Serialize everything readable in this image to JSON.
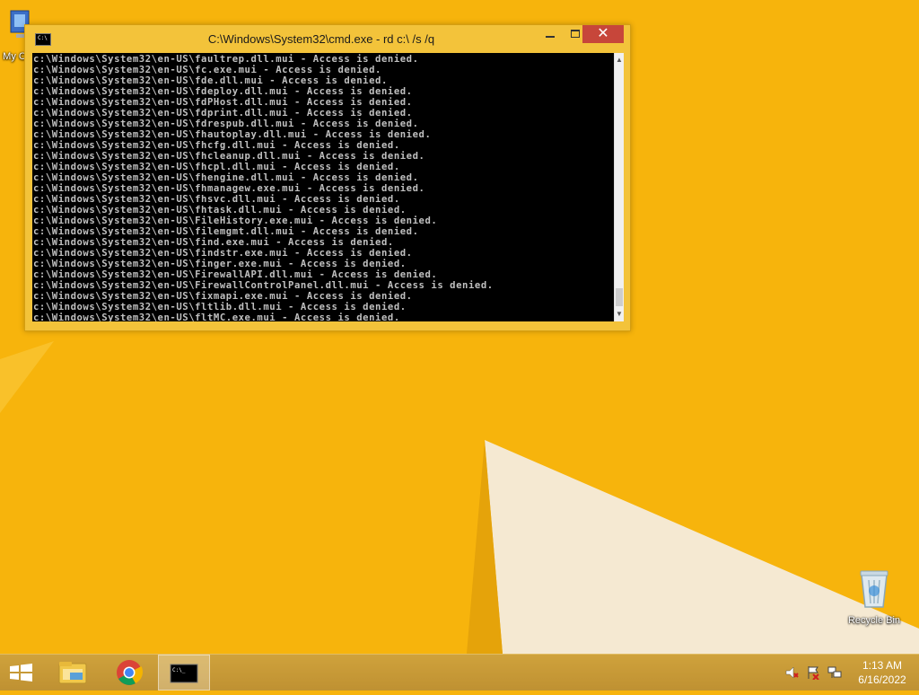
{
  "desktop": {
    "icons": [
      {
        "label": "My C"
      },
      {
        "label": "Recycle Bin"
      }
    ]
  },
  "cmd_window": {
    "title": "C:\\Windows\\System32\\cmd.exe - rd  c:\\ /s /q",
    "close_glyph": "✕",
    "lines": [
      "c:\\Windows\\System32\\en-US\\faultrep.dll.mui - Access is denied.",
      "c:\\Windows\\System32\\en-US\\fc.exe.mui - Access is denied.",
      "c:\\Windows\\System32\\en-US\\fde.dll.mui - Access is denied.",
      "c:\\Windows\\System32\\en-US\\fdeploy.dll.mui - Access is denied.",
      "c:\\Windows\\System32\\en-US\\fdPHost.dll.mui - Access is denied.",
      "c:\\Windows\\System32\\en-US\\fdprint.dll.mui - Access is denied.",
      "c:\\Windows\\System32\\en-US\\fdrespub.dll.mui - Access is denied.",
      "c:\\Windows\\System32\\en-US\\fhautoplay.dll.mui - Access is denied.",
      "c:\\Windows\\System32\\en-US\\fhcfg.dll.mui - Access is denied.",
      "c:\\Windows\\System32\\en-US\\fhcleanup.dll.mui - Access is denied.",
      "c:\\Windows\\System32\\en-US\\fhcpl.dll.mui - Access is denied.",
      "c:\\Windows\\System32\\en-US\\fhengine.dll.mui - Access is denied.",
      "c:\\Windows\\System32\\en-US\\fhmanagew.exe.mui - Access is denied.",
      "c:\\Windows\\System32\\en-US\\fhsvc.dll.mui - Access is denied.",
      "c:\\Windows\\System32\\en-US\\fhtask.dll.mui - Access is denied.",
      "c:\\Windows\\System32\\en-US\\FileHistory.exe.mui - Access is denied.",
      "c:\\Windows\\System32\\en-US\\filemgmt.dll.mui - Access is denied.",
      "c:\\Windows\\System32\\en-US\\find.exe.mui - Access is denied.",
      "c:\\Windows\\System32\\en-US\\findstr.exe.mui - Access is denied.",
      "c:\\Windows\\System32\\en-US\\finger.exe.mui - Access is denied.",
      "c:\\Windows\\System32\\en-US\\FirewallAPI.dll.mui - Access is denied.",
      "c:\\Windows\\System32\\en-US\\FirewallControlPanel.dll.mui - Access is denied.",
      "c:\\Windows\\System32\\en-US\\fixmapi.exe.mui - Access is denied.",
      "c:\\Windows\\System32\\en-US\\fltlib.dll.mui - Access is denied.",
      "c:\\Windows\\System32\\en-US\\fltMC.exe.mui - Access is denied."
    ]
  },
  "taskbar": {
    "time": "1:13 AM",
    "date": "6/16/2022",
    "pinned": [
      "start-icon",
      "file-explorer-icon",
      "chrome-icon",
      "command-prompt-icon"
    ],
    "tray": [
      "volume-muted-icon",
      "action-center-icon",
      "network-icon"
    ]
  },
  "colors": {
    "wallpaper": "#f7b40c",
    "window_frame": "#f3c33a",
    "close_button": "#c7463a",
    "console_bg": "#000000",
    "console_text": "#c0c0c0"
  }
}
